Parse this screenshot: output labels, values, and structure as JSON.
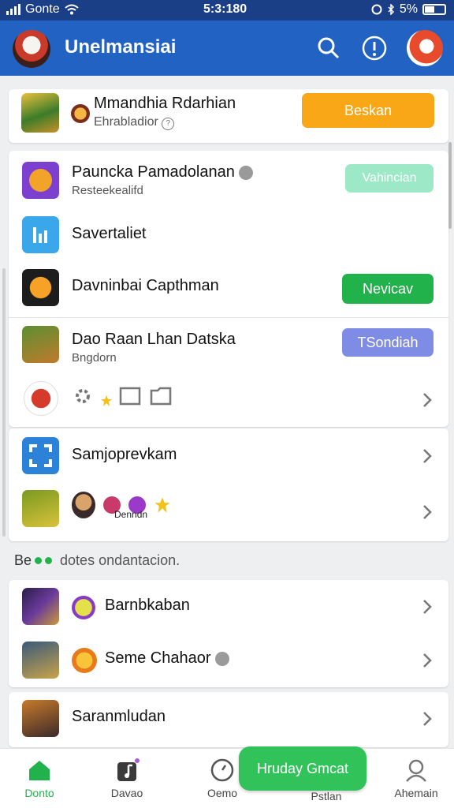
{
  "status_bar": {
    "carrier": "Gonte",
    "time": "5:3:180",
    "battery": "5%"
  },
  "app_bar": {
    "title": "Unelmansiai",
    "icons": [
      "app-logo",
      "search-icon",
      "info-icon",
      "profile-avatar"
    ]
  },
  "featured": {
    "title": "Mmandhia Rdarhian",
    "subtitle": "Ehrabladior",
    "button": "Beskan",
    "button_color": "#f9a716"
  },
  "group1": [
    {
      "title": "Pauncka Pamadolanan",
      "subtitle": "Resteekealifd",
      "button": "Vahincian",
      "button_color": "#9de8c6"
    },
    {
      "title": "Savertaliet"
    },
    {
      "title": "Davninbai Capthman",
      "button": "Nevicav",
      "button_color": "#22b24c"
    },
    {
      "title": "Dao Raan Lhan Datska",
      "subtitle": "Bngdorn",
      "button": "TSondiah",
      "button_color": "#7e8ce6"
    }
  ],
  "group2": [
    {
      "title": "Samjoprevkam"
    },
    {
      "title": "Denndn"
    }
  ],
  "section_label": "dotes ondantacion.",
  "section_prefix": "Be",
  "group3": [
    {
      "title": "Barnbkaban"
    },
    {
      "title": "Seme Chahaor"
    }
  ],
  "group4": [
    {
      "title": "Saranmludan"
    }
  ],
  "bottom_nav": [
    {
      "label": "Donto",
      "active": true
    },
    {
      "label": "Davao"
    },
    {
      "label": "Oemo"
    },
    {
      "label": "Pstlan"
    },
    {
      "label": "Ahemain"
    }
  ],
  "fab": {
    "label": "Hruday Gmcat"
  },
  "colors": {
    "primary": "#2262c2",
    "status": "#1a3f86",
    "active": "#22b24c"
  }
}
